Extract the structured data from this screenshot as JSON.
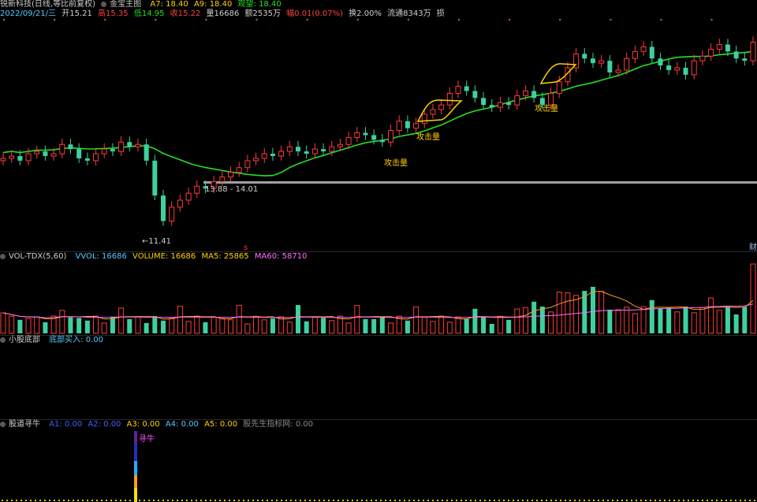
{
  "header": {
    "title": "锐新科技(日线,等比前复权)",
    "indicator": "金宝主图",
    "a7": "A7: 18.40",
    "a9": "A9: 18.40",
    "guanwang": "观望: 18.40",
    "date": "2022/09/21/三",
    "open": "开15.21",
    "high": "高15.35",
    "low": "低14.95",
    "close": "收15.22",
    "volume": "量16686",
    "amount": "额2535万",
    "change": "幅0.01(0.07%)",
    "turnover": "换2.00%",
    "float": "流通8343万",
    "tag": "损"
  },
  "main_chart": {
    "label_low": "←11.41",
    "label_range": "13.88 - 14.01",
    "attack_labels": [
      "攻击量",
      "攻击量",
      "攻击量"
    ],
    "marker_s": "s",
    "edge_label": "财",
    "colors": {
      "up": "#ff3b3b",
      "down": "#3fd0a0",
      "ma": "#22e022",
      "signal": "#ffd200"
    },
    "close_series": [
      14.7,
      14.8,
      14.6,
      14.9,
      15.0,
      14.8,
      14.9,
      15.3,
      15.1,
      14.7,
      14.6,
      14.9,
      15.1,
      15.0,
      15.4,
      15.2,
      15.3,
      14.6,
      13.1,
      12.0,
      12.6,
      12.9,
      13.2,
      13.5,
      13.4,
      13.7,
      13.9,
      14.1,
      14.3,
      14.6,
      14.7,
      14.9,
      14.8,
      15.0,
      15.2,
      15.0,
      14.9,
      15.1,
      15.0,
      15.2,
      15.3,
      15.6,
      15.8,
      15.7,
      15.5,
      15.4,
      15.9,
      16.3,
      16.0,
      16.2,
      16.6,
      16.8,
      17.0,
      17.5,
      17.8,
      17.6,
      17.3,
      17.0,
      16.9,
      17.1,
      17.0,
      17.4,
      17.6,
      17.3,
      17.0,
      17.5,
      18.0,
      18.6,
      19.2,
      19.0,
      18.8,
      18.9,
      18.4,
      18.5,
      19.0,
      19.3,
      19.5,
      19.0,
      18.7,
      18.5,
      18.6,
      18.3,
      18.9,
      19.1,
      19.4,
      19.6,
      19.3,
      19.0,
      18.9,
      19.7
    ]
  },
  "vol_panel": {
    "name": "VOL-TDX(5,60)",
    "vvol": "VVOL: 16686",
    "volume": "VOLUME: 16686",
    "ma5": "MA5: 25865",
    "ma60": "MA60: 58710"
  },
  "panel2": {
    "name": "小股底部",
    "buy": "底部买入: 0.00"
  },
  "panel3": {
    "name": "股道寻牛",
    "a1": "A1: 0.00",
    "a2": "A2: 0.00",
    "a3": "A3: 0.00",
    "a4": "A4: 0.00",
    "a5": "A5: 0.00",
    "extra": "股先生指标网: 0.00",
    "signal": "寻牛"
  }
}
